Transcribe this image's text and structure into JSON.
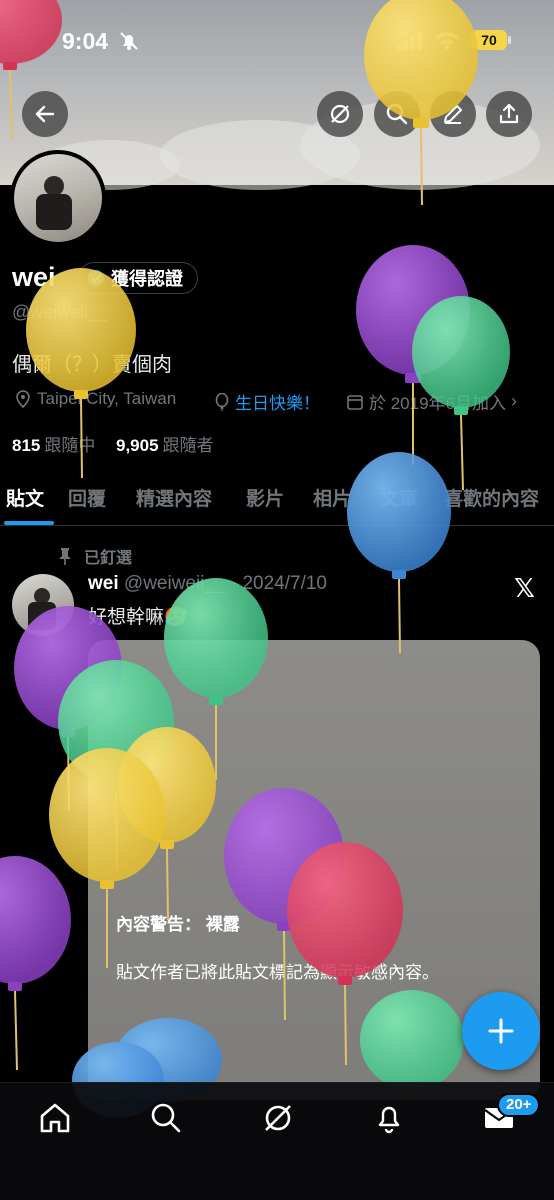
{
  "status_bar": {
    "time": "9:04",
    "battery": "70"
  },
  "profile": {
    "name": "wei",
    "verify_label": "獲得認證",
    "handle": "@weiweii__",
    "bio": "偶爾（？）賣個肉",
    "location": "Taipei City, Taiwan",
    "birthday": "生日快樂！",
    "joined": "於 2019年6月加入",
    "following_count": "815",
    "following_label": "跟隨中",
    "followers_count": "9,905",
    "followers_label": "跟隨者"
  },
  "tabs": [
    {
      "label": "貼文",
      "active": true
    },
    {
      "label": "回覆"
    },
    {
      "label": "精選內容"
    },
    {
      "label": "影片"
    },
    {
      "label": "相片"
    },
    {
      "label": "文章"
    },
    {
      "label": "喜歡的內容"
    }
  ],
  "post": {
    "pinned_label": "已釘選",
    "author": "wei",
    "handle_date": "@weiweii__ · 2024/7/10",
    "text": "好想幹嘛🥵",
    "warning_title": "內容警告： 裸露",
    "warning_body": "貼文作者已將此貼文標記為顯示敏感內容。"
  },
  "bottom_nav": {
    "message_badge": "20+"
  },
  "colors": {
    "accent": "#1d9bf0",
    "background": "#000000",
    "muted": "#71767b"
  },
  "icons": [
    "back-arrow-icon",
    "grok-icon",
    "search-icon",
    "edit-icon",
    "share-icon",
    "verified-badge-icon",
    "location-icon",
    "balloon-icon",
    "calendar-icon",
    "pin-icon",
    "x-logo-icon",
    "plus-icon",
    "home-icon",
    "mail-icon",
    "bell-icon"
  ]
}
